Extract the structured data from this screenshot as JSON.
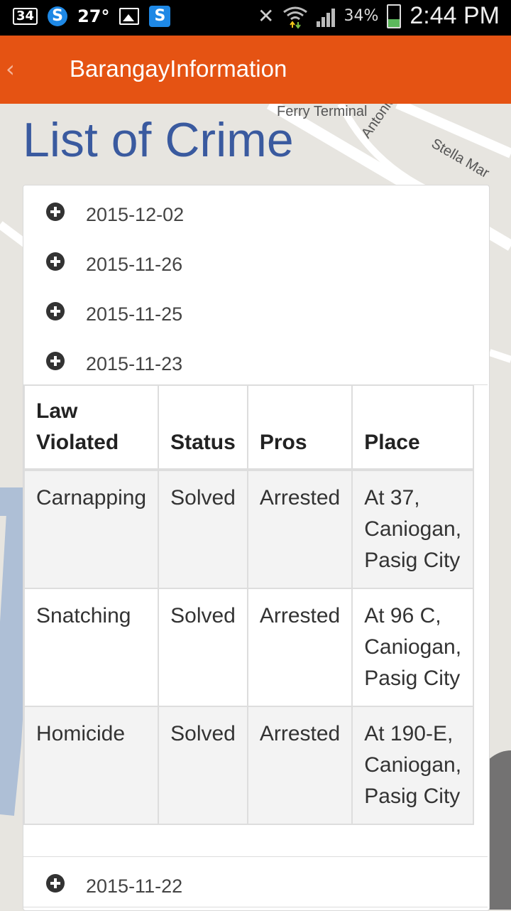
{
  "status_bar": {
    "notif_count": "34",
    "temperature": "27°",
    "battery_pct": "34%",
    "time": "2:44 PM",
    "icons": [
      "s-app-icon",
      "gallery-icon",
      "skype-icon",
      "mute-icon",
      "wifi-icon",
      "signal-icon",
      "battery-icon"
    ]
  },
  "app_bar": {
    "back": "‹",
    "title": "BarangayInformation"
  },
  "map_labels": {
    "ferry": "Ferry Terminal",
    "antonio": "Antonio Av",
    "stella": "Stella Mar"
  },
  "page_title": "List of Crime",
  "accordion": [
    {
      "date": "2015-12-02"
    },
    {
      "date": "2015-11-26"
    },
    {
      "date": "2015-11-25"
    },
    {
      "date": "2015-11-23"
    }
  ],
  "table": {
    "headers": [
      "Law Violated",
      "Status",
      "Pros",
      "Place"
    ],
    "rows": [
      [
        "Carnapping",
        "Solved",
        "Arrested",
        "At 37, Caniogan, Pasig City"
      ],
      [
        "Snatching",
        "Solved",
        "Arrested",
        "At 96 C, Caniogan, Pasig City"
      ],
      [
        "Homicide",
        "Solved",
        "Arrested",
        "At 190-E, Caniogan, Pasig City"
      ]
    ]
  },
  "accordion_after": {
    "date": "2015-11-22"
  },
  "colors": {
    "app_bar": "#e55313",
    "title": "#3a5a9f"
  }
}
